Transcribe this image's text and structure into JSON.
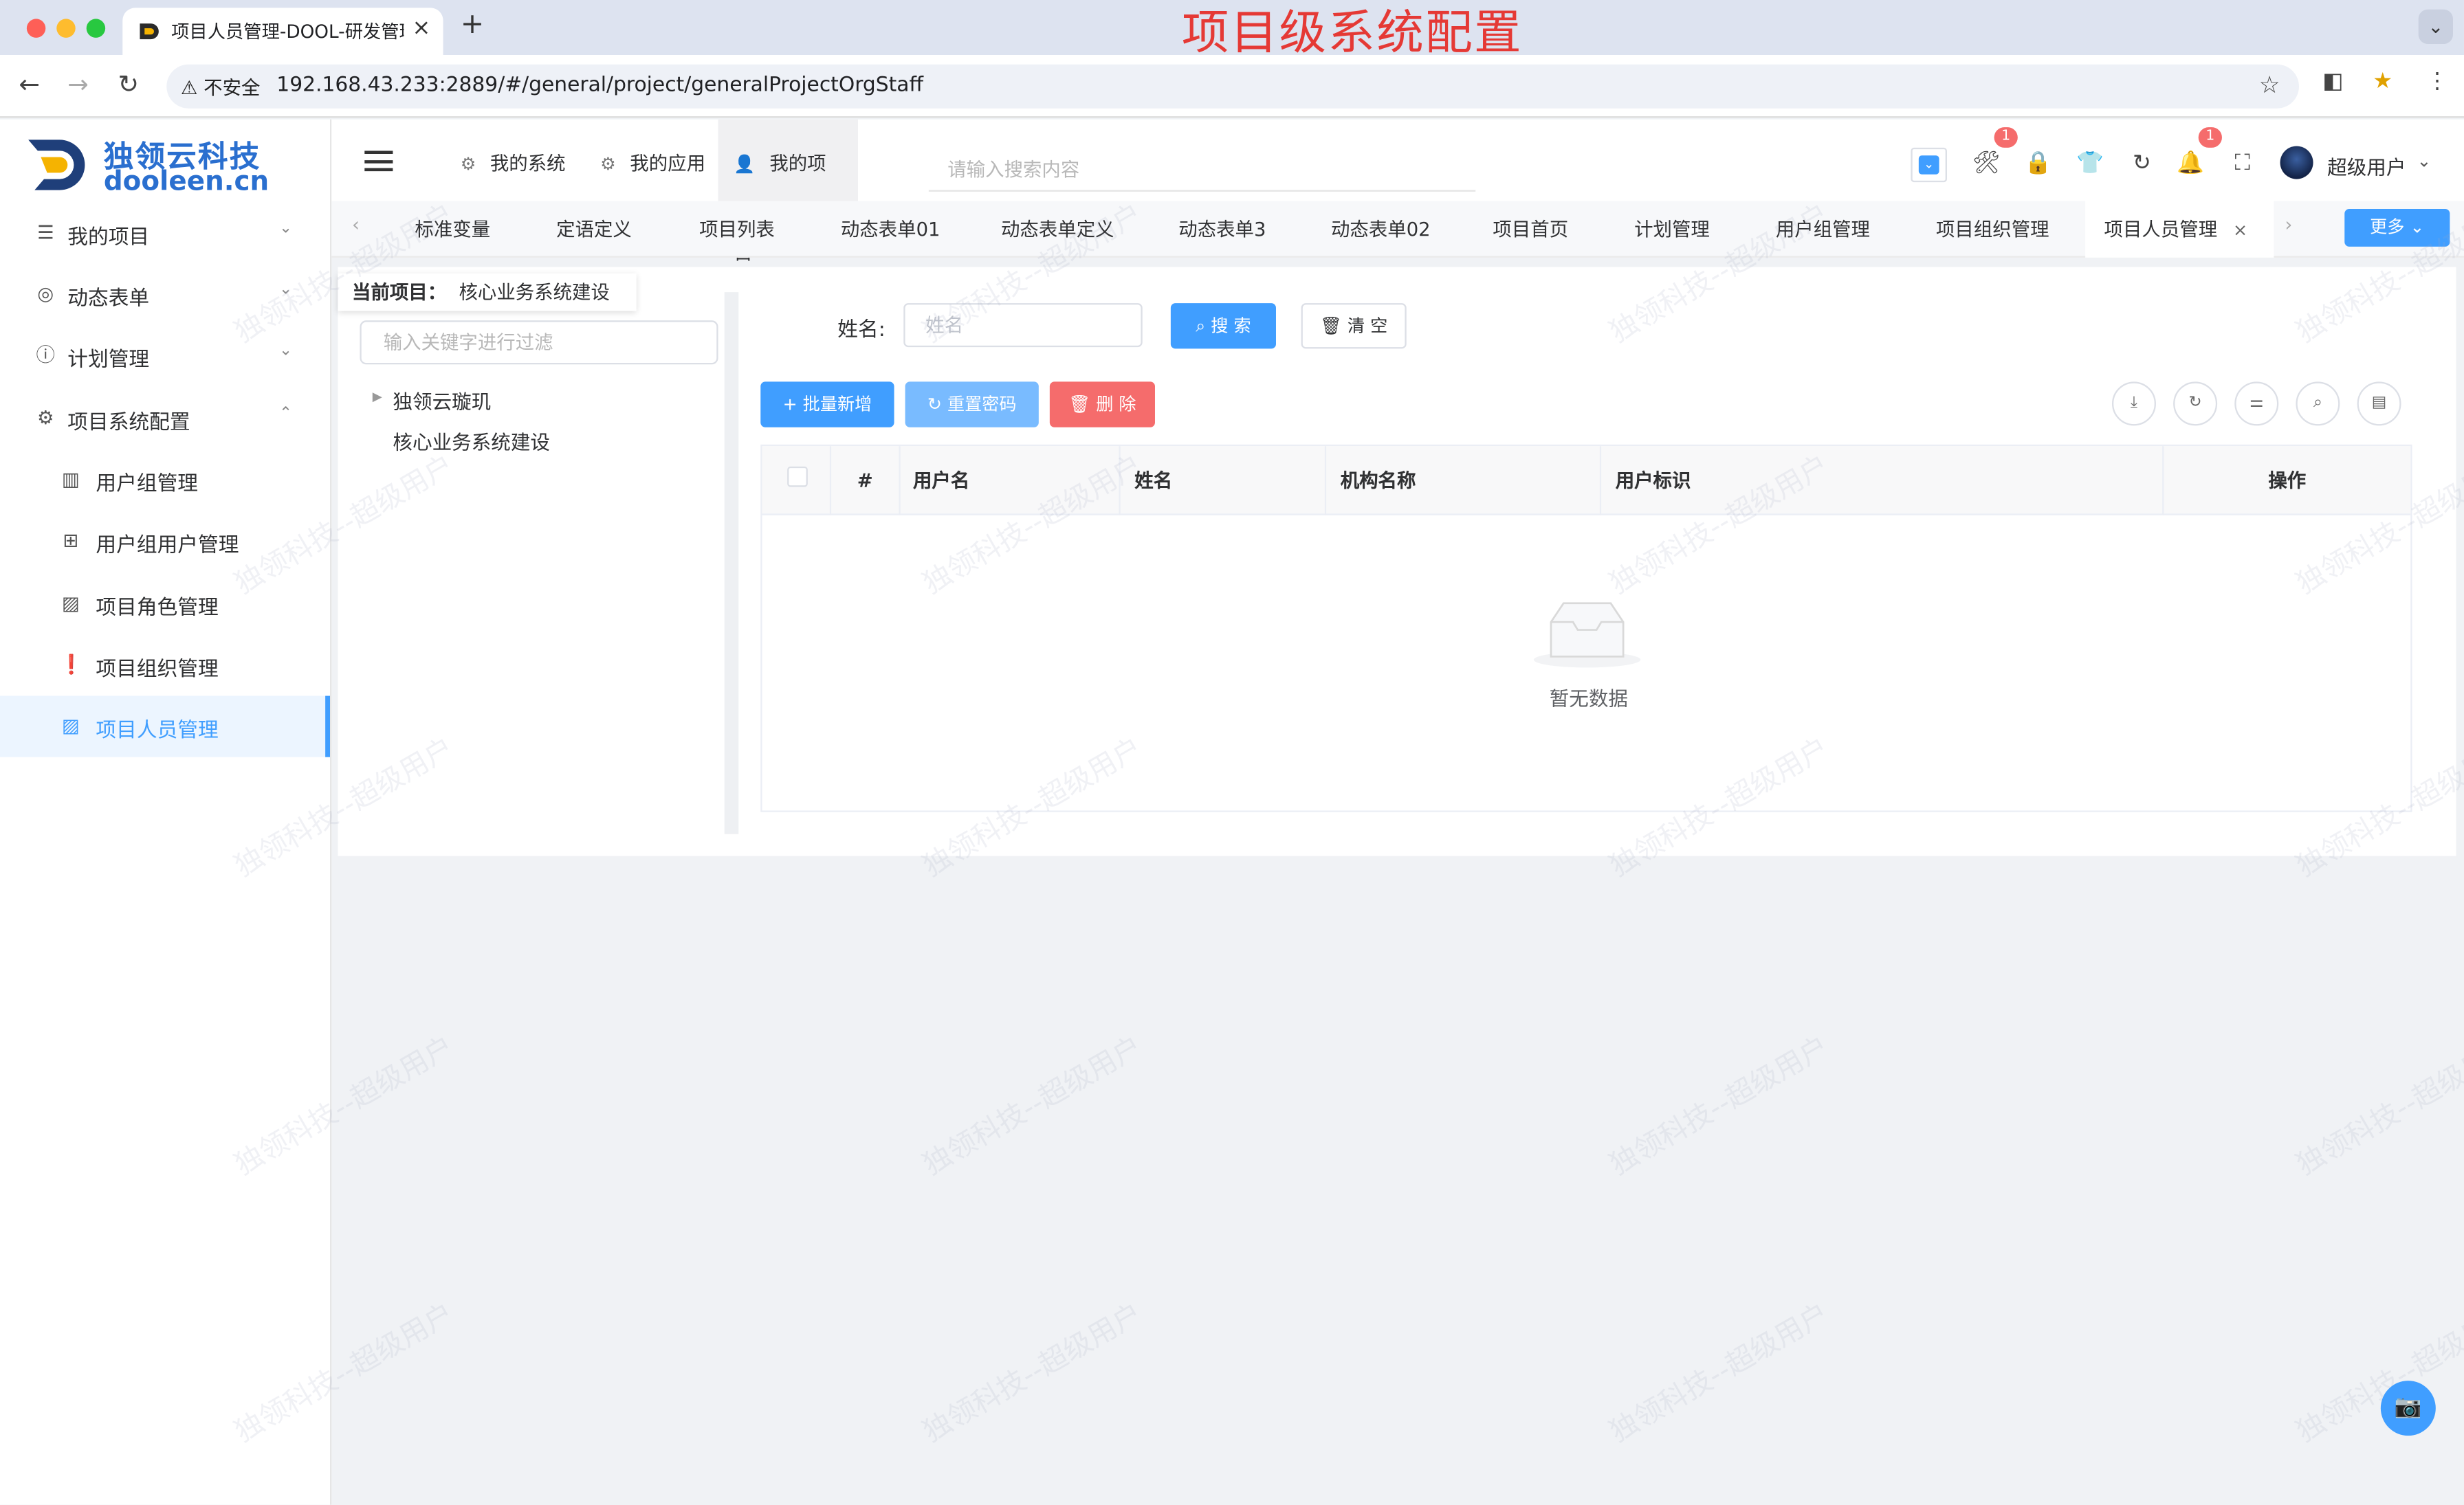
{
  "browser": {
    "tab_title": "项目人员管理-DOOL-研发管理",
    "tab_close": "×",
    "new_tab": "+",
    "overlay_title": "项目级系统配置",
    "security_label": "不安全",
    "url": "192.168.43.233:2889/#/general/project/generalProjectOrgStaff"
  },
  "logo": {
    "cn": "独领云科技",
    "en": "dooleen.cn"
  },
  "sidebar": {
    "items": [
      {
        "label": "我的项目",
        "icon": "sliders-icon",
        "arrow": "⌄"
      },
      {
        "label": "动态表单",
        "icon": "lifebuoy-icon",
        "arrow": "⌄"
      },
      {
        "label": "计划管理",
        "icon": "info-icon",
        "arrow": "⌄"
      },
      {
        "label": "项目系统配置",
        "icon": "gear-icon",
        "arrow": "⌃"
      }
    ],
    "sub_items": [
      {
        "label": "用户组管理",
        "icon": "calendar-icon"
      },
      {
        "label": "用户组用户管理",
        "icon": "folder-plus-icon"
      },
      {
        "label": "项目角色管理",
        "icon": "image-icon"
      },
      {
        "label": "项目组织管理",
        "icon": "alert-icon"
      },
      {
        "label": "项目人员管理",
        "icon": "image-icon",
        "active": true
      }
    ]
  },
  "navbar": {
    "tabs": [
      {
        "label": "我的系统",
        "icon": "gear-icon"
      },
      {
        "label": "我的应用",
        "icon": "gear-icon"
      },
      {
        "label": "我的项目",
        "icon": "user-icon",
        "active": true
      }
    ],
    "search_placeholder": "请输入搜索内容",
    "badge_1": "1",
    "badge_2": "1",
    "username": "超级用户"
  },
  "tagsview": {
    "tags": [
      "标准变量",
      "定语定义",
      "项目列表",
      "动态表单01",
      "动态表单定义",
      "动态表单3",
      "动态表单02",
      "项目首页",
      "计划管理",
      "用户组管理",
      "项目组织管理",
      "项目人员管理"
    ],
    "active_tag": "项目人员管理",
    "more_label": "更多"
  },
  "content": {
    "current_project_label": "当前项目：",
    "current_project_value": "核心业务系统建设",
    "tree_filter_placeholder": "输入关键字进行过滤",
    "tree": [
      "独领云璇玑",
      "核心业务系统建设"
    ],
    "search_form": {
      "name_label": "姓名:",
      "name_placeholder": "姓名",
      "search_button": "搜 索",
      "clear_button": "清 空"
    },
    "toolbar": {
      "batch_add": "批量新增",
      "reset_password": "重置密码",
      "delete": "删 除"
    },
    "table": {
      "columns": [
        "#",
        "用户名",
        "姓名",
        "机构名称",
        "用户标识",
        "操作"
      ],
      "rows": [],
      "empty_text": "暂无数据"
    }
  },
  "watermark": "独领科技--超级用户",
  "colors": {
    "primary": "#409eff",
    "danger": "#f56c6c",
    "title_red": "#e53935"
  }
}
